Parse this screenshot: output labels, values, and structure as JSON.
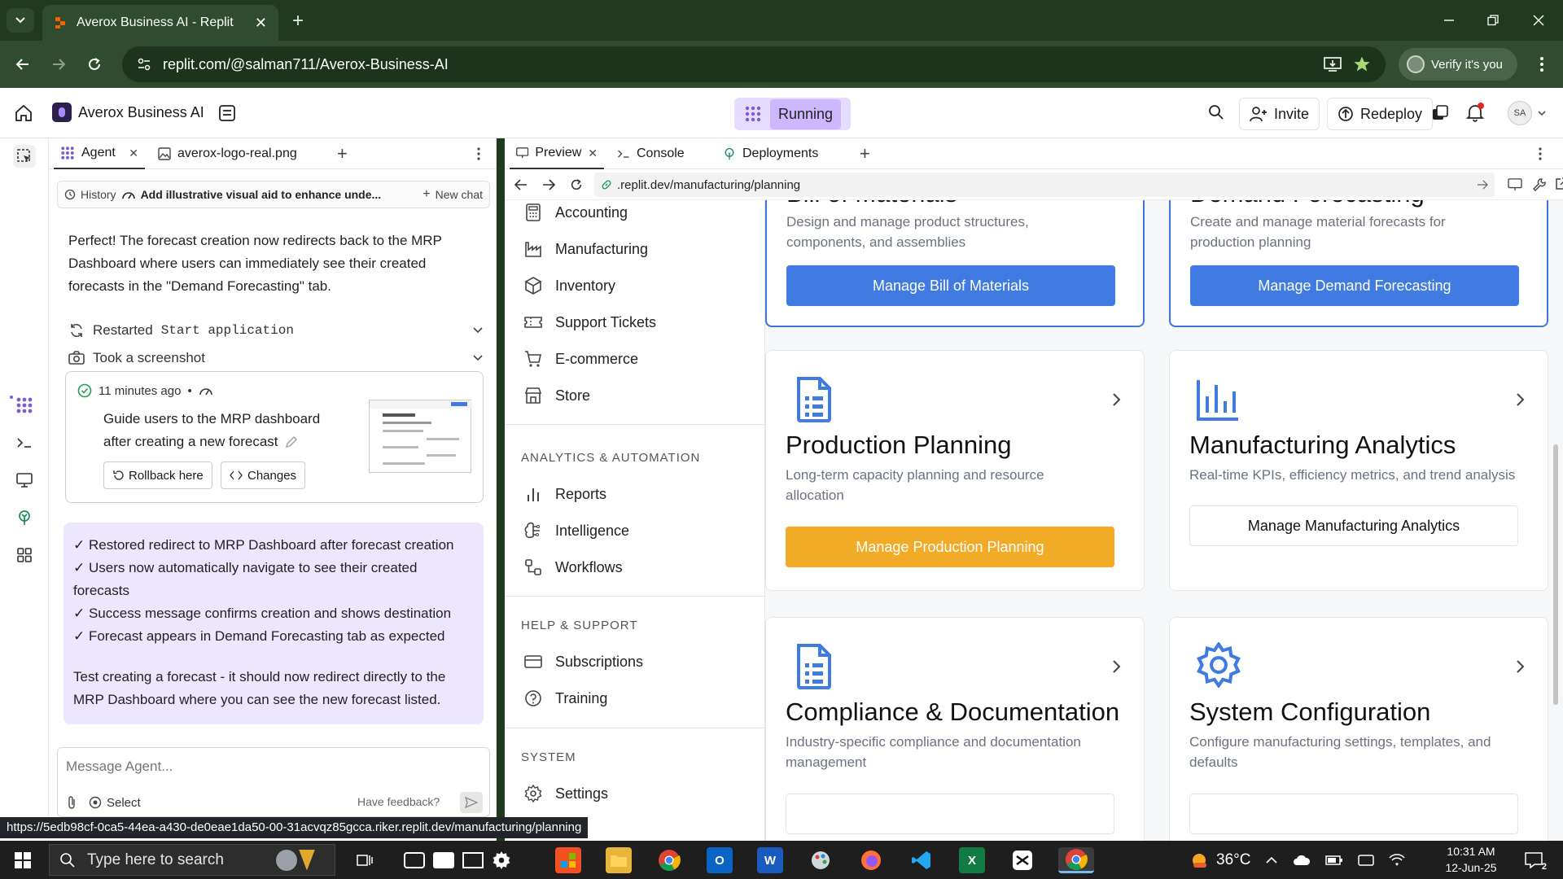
{
  "browser": {
    "tab_title": "Averox Business AI - Replit",
    "url": "replit.com/@salman711/Averox-Business-AI",
    "verify_label": "Verify it's you"
  },
  "replit": {
    "project_name": "Averox Business AI",
    "run_status": "Running",
    "invite_label": "Invite",
    "redeploy_label": "Redeploy",
    "avatar_initials": "SA"
  },
  "agent_panel": {
    "tabs": [
      {
        "label": "Agent"
      },
      {
        "label": "averox-logo-real.png"
      }
    ],
    "history_label": "History",
    "chat_title": "Add illustrative visual aid to enhance unde...",
    "new_chat_label": "New chat",
    "message_lines": [
      "Perfect! The forecast creation now redirects back to the MRP",
      "Dashboard where users can immediately see their created",
      "forecasts in the \"Demand Forecasting\" tab."
    ],
    "steps": [
      {
        "prefix": "Restarted",
        "mono": "Start application"
      },
      {
        "prefix": "Took a screenshot",
        "mono": ""
      }
    ],
    "checkpoint": {
      "time": "11 minutes ago",
      "desc_line1": "Guide users to the MRP dashboard",
      "desc_line2": "after creating a new forecast",
      "rollback_label": "Rollback here",
      "changes_label": "Changes"
    },
    "summary_lines": [
      "✓ Restored redirect to MRP Dashboard after forecast creation",
      "✓ Users now automatically navigate to see their created",
      "forecasts",
      "✓ Success message confirms creation and shows destination",
      "✓ Forecast appears in Demand Forecasting tab as expected"
    ],
    "summary_footer_line1": "Test creating a forecast - it should now redirect directly to the",
    "summary_footer_line2": "MRP Dashboard where you can see the new forecast listed.",
    "input_placeholder": "Message Agent...",
    "select_label": "Select",
    "feedback_label": "Have feedback?"
  },
  "right_panel": {
    "tabs": [
      {
        "label": "Preview"
      },
      {
        "label": "Console"
      },
      {
        "label": "Deployments"
      }
    ],
    "preview_url": ".replit.dev/manufacturing/planning"
  },
  "app_nav": {
    "items_top": [
      {
        "label": "Accounting",
        "icon": "calculator-icon"
      },
      {
        "label": "Manufacturing",
        "icon": "factory-icon"
      },
      {
        "label": "Inventory",
        "icon": "box-icon"
      },
      {
        "label": "Support Tickets",
        "icon": "ticket-icon"
      },
      {
        "label": "E-commerce",
        "icon": "cart-icon"
      },
      {
        "label": "Store",
        "icon": "store-icon"
      }
    ],
    "section_analytics": "ANALYTICS & AUTOMATION",
    "items_analytics": [
      {
        "label": "Reports",
        "icon": "bar-chart-icon"
      },
      {
        "label": "Intelligence",
        "icon": "brain-icon"
      },
      {
        "label": "Workflows",
        "icon": "workflow-icon"
      }
    ],
    "section_help": "HELP & SUPPORT",
    "items_help": [
      {
        "label": "Subscriptions",
        "icon": "card-icon"
      },
      {
        "label": "Training",
        "icon": "help-circle-icon"
      }
    ],
    "section_system": "SYSTEM",
    "items_system": [
      {
        "label": "Settings",
        "icon": "gear-icon"
      }
    ]
  },
  "cards": {
    "bom": {
      "title": "Bill of Materials",
      "desc_line1": "Design and manage product structures,",
      "desc_line2": "components, and assemblies",
      "button": "Manage Bill of Materials"
    },
    "demand": {
      "title": "Demand Forecasting",
      "desc_line1": "Create and manage material forecasts for",
      "desc_line2": "production planning",
      "button": "Manage Demand Forecasting"
    },
    "production": {
      "title": "Production Planning",
      "desc_line1": "Long-term capacity planning and resource",
      "desc_line2": "allocation",
      "button": "Manage Production Planning"
    },
    "analytics": {
      "title": "Manufacturing Analytics",
      "desc_line1": "Real-time KPIs, efficiency metrics, and trend analysis",
      "button": "Manage Manufacturing Analytics"
    },
    "compliance": {
      "title": "Compliance & Documentation",
      "desc_line1": "Industry-specific compliance and documentation",
      "desc_line2": "management"
    },
    "sysconfig": {
      "title": "System Configuration",
      "desc_line1": "Configure manufacturing settings, templates, and",
      "desc_line2": "defaults"
    }
  },
  "status_link": "https://5edb98cf-0ca5-44ea-a430-de0eae1da50-00-31acvqz85gcca.riker.replit.dev/manufacturing/planning",
  "taskbar": {
    "search_placeholder": "Type here to search",
    "temperature": "36°C",
    "time": "10:31 AM",
    "date": "12-Jun-25",
    "notification_count": "2"
  },
  "colors": {
    "chrome_dark": "#1f3a1e",
    "accent_blue": "#3f7be0",
    "accent_orange": "#f2ab26",
    "agent_summary_bg": "#ede6ff",
    "running_bg": "#e6dcff"
  }
}
